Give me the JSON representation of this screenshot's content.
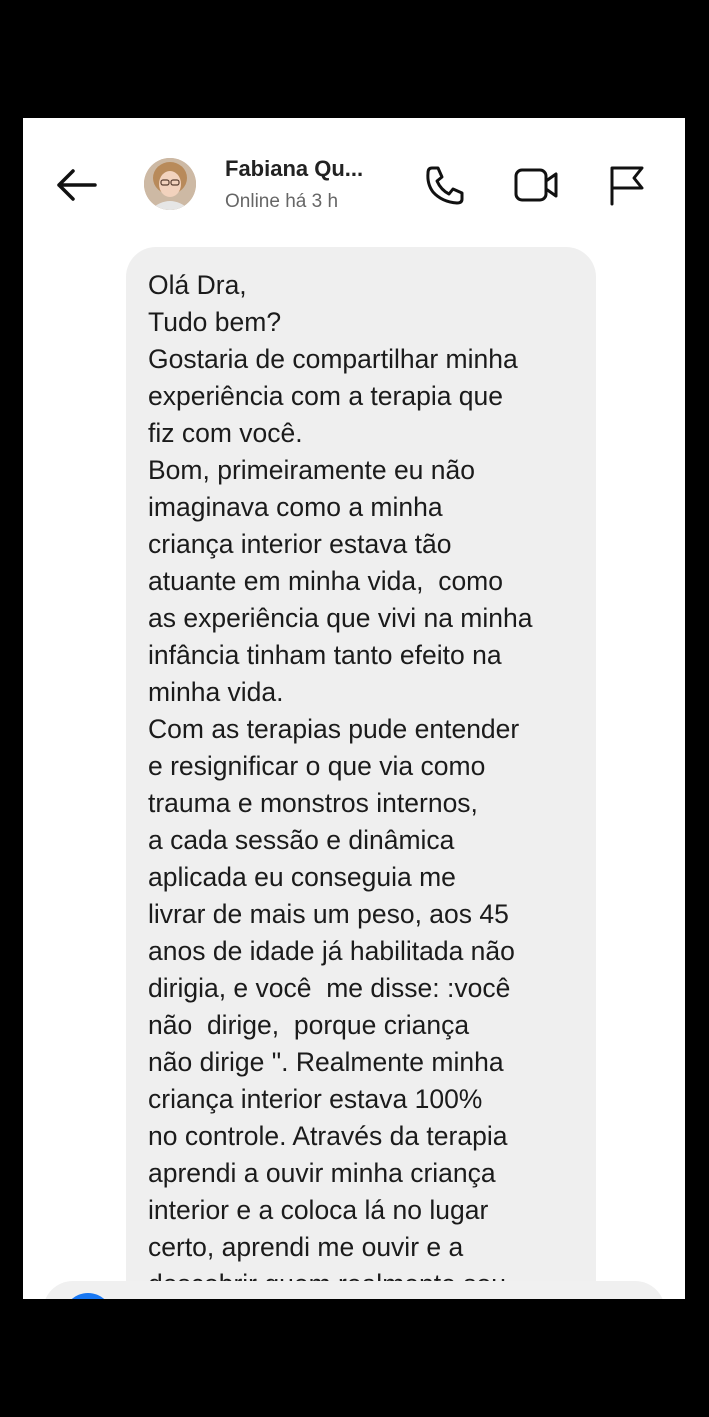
{
  "header": {
    "contact_name": "Fabiana Qu...",
    "status": "Online há 3 h",
    "icons": [
      "arrow-left-icon",
      "phone-icon",
      "video-icon",
      "flag-icon"
    ]
  },
  "message": {
    "lines": [
      "Olá Dra,",
      "Tudo bem?",
      "Gostaria de compartilhar minha",
      "experiência com a terapia que",
      "fiz com você.",
      "Bom, primeiramente eu não",
      "imaginava como a minha",
      "criança interior estava tão",
      "atuante em minha vida,  como",
      "as experiência que vivi na minha",
      "infância tinham tanto efeito na",
      "minha vida.",
      "Com as terapias pude entender",
      "e resignificar o que via como",
      "trauma e monstros internos,",
      "a cada sessão e dinâmica",
      "aplicada eu conseguia me",
      "livrar de mais um peso, aos 45",
      "anos de idade já habilitada não",
      "dirigia, e você  me disse: :você",
      "não  dirige,  porque criança",
      "não dirige \". Realmente minha",
      "criança interior estava 100%",
      "no controle. Através da terapia",
      "aprendi a ouvir minha criança",
      "interior e a coloca lá no lugar",
      "certo, aprendi me ouvir e a",
      "descobrir quem realmente sou"
    ]
  },
  "colors": {
    "background": "#000000",
    "screen": "#ffffff",
    "bubble": "#efefef",
    "accent": "#1877f2"
  }
}
